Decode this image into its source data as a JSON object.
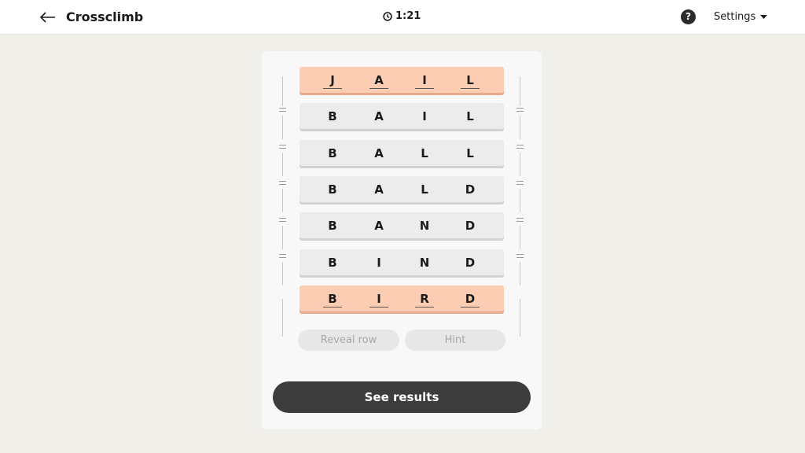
{
  "header": {
    "back_icon": "arrow-left-icon",
    "title": "Crossclimb",
    "timer_icon": "clock-icon",
    "timer": "1:21",
    "help_icon": "question-circle-icon",
    "help_glyph": "?",
    "settings_label": "Settings",
    "settings_icon": "caret-down-icon"
  },
  "puzzle": {
    "rows": [
      {
        "letters": [
          "J",
          "A",
          "I",
          "L"
        ],
        "locked": true
      },
      {
        "letters": [
          "B",
          "A",
          "I",
          "L"
        ],
        "locked": false
      },
      {
        "letters": [
          "B",
          "A",
          "L",
          "L"
        ],
        "locked": false
      },
      {
        "letters": [
          "B",
          "A",
          "L",
          "D"
        ],
        "locked": false
      },
      {
        "letters": [
          "B",
          "A",
          "N",
          "D"
        ],
        "locked": false
      },
      {
        "letters": [
          "B",
          "I",
          "N",
          "D"
        ],
        "locked": false
      },
      {
        "letters": [
          "B",
          "I",
          "R",
          "D"
        ],
        "locked": true
      }
    ]
  },
  "actions": {
    "reveal_row": "Reveal row",
    "hint": "Hint",
    "see_results": "See results"
  },
  "colors": {
    "locked_row": "#fdcdb3",
    "normal_row": "#ececec",
    "primary_button": "#3c3c3c"
  }
}
